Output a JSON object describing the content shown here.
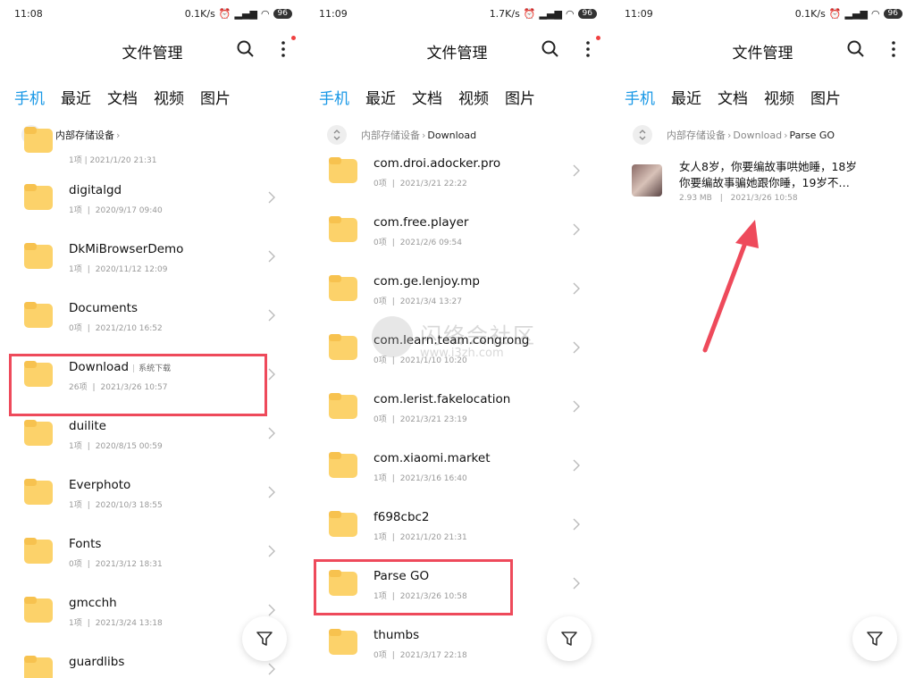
{
  "common": {
    "title": "文件管理",
    "tabs": [
      "手机",
      "最近",
      "文档",
      "视频",
      "图片"
    ],
    "battery": "96",
    "root_crumb": "内部存储设备",
    "separator": "|"
  },
  "panel1": {
    "time": "11:08",
    "speed": "0.1K/s",
    "breadcrumb": [
      "内部存储设备"
    ],
    "top_partial_meta": "1项 | 2021/1/20 21:31",
    "folders": [
      {
        "name": "digitalgd",
        "count": "1项",
        "date": "2020/9/17 09:40"
      },
      {
        "name": "DkMiBrowserDemo",
        "count": "1项",
        "date": "2020/11/12 12:09"
      },
      {
        "name": "Documents",
        "count": "0项",
        "date": "2021/2/10 16:52"
      },
      {
        "name": "Download",
        "tag": "系统下载",
        "count": "26项",
        "date": "2021/3/26 10:57"
      },
      {
        "name": "duilite",
        "count": "1项",
        "date": "2020/8/15 00:59"
      },
      {
        "name": "Everphoto",
        "count": "1项",
        "date": "2020/10/3 18:55"
      },
      {
        "name": "Fonts",
        "count": "0项",
        "date": "2021/3/12 18:31"
      },
      {
        "name": "gmcchh",
        "count": "1项",
        "date": "2021/3/24 13:18"
      },
      {
        "name": "guardlibs",
        "count": "",
        "date": ""
      }
    ]
  },
  "panel2": {
    "time": "11:09",
    "speed": "1.7K/s",
    "breadcrumb": [
      "内部存储设备",
      "Download"
    ],
    "folders": [
      {
        "name": "com.droi.adocker.pro",
        "count": "0项",
        "date": "2021/3/21 22:22"
      },
      {
        "name": "com.free.player",
        "count": "0项",
        "date": "2021/2/6 09:54"
      },
      {
        "name": "com.ge.lenjoy.mp",
        "count": "0项",
        "date": "2021/3/4 13:27"
      },
      {
        "name": "com.learn.team.congrong",
        "count": "0项",
        "date": "2021/1/10 10:20"
      },
      {
        "name": "com.lerist.fakelocation",
        "count": "0项",
        "date": "2021/3/21 23:19"
      },
      {
        "name": "com.xiaomi.market",
        "count": "1项",
        "date": "2021/3/16 16:40"
      },
      {
        "name": "f698cbc2",
        "count": "1项",
        "date": "2021/1/20 21:31"
      },
      {
        "name": "Parse GO",
        "count": "1项",
        "date": "2021/3/26 10:58"
      },
      {
        "name": "thumbs",
        "count": "0项",
        "date": "2021/3/17 22:18"
      }
    ]
  },
  "panel3": {
    "time": "11:09",
    "speed": "0.1K/s",
    "breadcrumb": [
      "内部存储设备",
      "Download",
      "Parse GO"
    ],
    "file": {
      "title": "女人8岁，你要编故事哄她睡，18岁你要编故事骗她跟你睡，19岁不…",
      "size": "2.93 MB",
      "date": "2021/3/26 10:58"
    }
  },
  "watermark": {
    "text": "闪络会社区",
    "url": "www.i3zh.com"
  },
  "colors": {
    "accent": "#1797e6",
    "folder": "#fcd26a",
    "highlight": "#ee4a5b",
    "arrow": "#ee4a5b"
  }
}
